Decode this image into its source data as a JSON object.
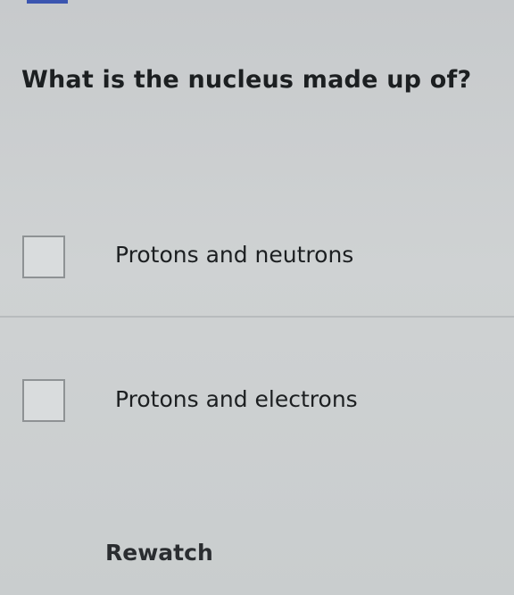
{
  "question": {
    "text": "What is the nucleus made up of?"
  },
  "options": [
    {
      "label": "Protons and neutrons",
      "checked": false
    },
    {
      "label": "Protons and electrons",
      "checked": false
    }
  ],
  "actions": {
    "rewatch_label": "Rewatch"
  }
}
